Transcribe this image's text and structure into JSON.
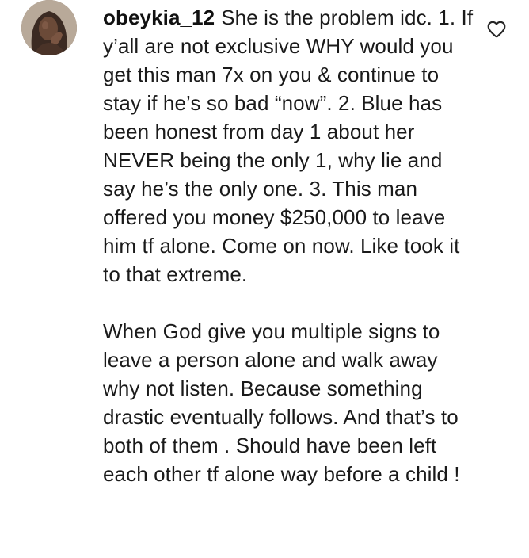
{
  "comment": {
    "username": "obeykia_12",
    "paragraphs": [
      "She is the problem idc. 1. If y’all are not exclusive WHY would you get this man 7x on you & continue to stay if he’s so bad “now”. 2. Blue has been honest from day 1 about her NEVER being the only 1, why lie and say he’s the only one. 3. This man offered you money $250,000 to leave him tf alone. Come on now. Like took it to that extreme.",
      "When God give you multiple signs to leave a person alone and walk away why not listen. Because something drastic eventually follows. And that’s to both of them . Should have been left each other tf alone way before a child !"
    ],
    "like_icon": "heart-outline-icon",
    "avatar_icon": "profile-photo"
  },
  "colors": {
    "text": "#1a1a1a",
    "background": "#ffffff",
    "icon_stroke": "#262626"
  }
}
